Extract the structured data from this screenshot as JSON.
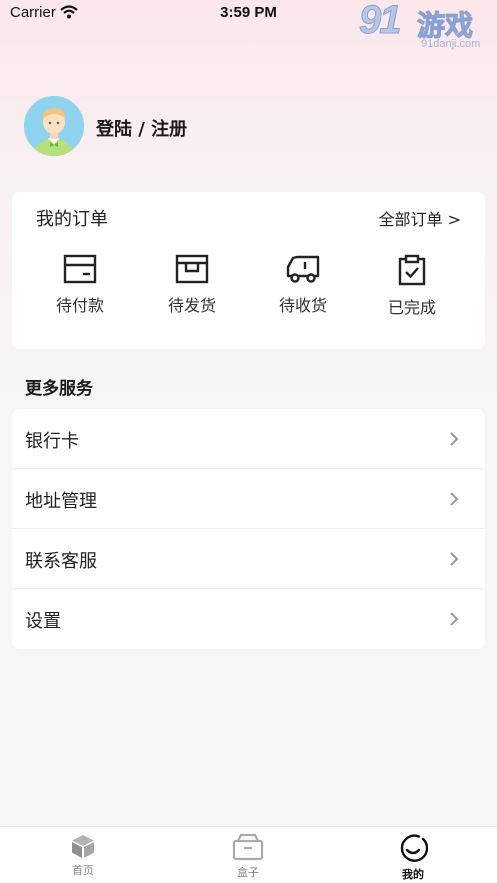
{
  "status_bar": {
    "carrier": "Carrier",
    "time": "3:59 PM"
  },
  "watermark": {
    "logo": "91",
    "name": "游戏",
    "url": "91danji.com"
  },
  "profile": {
    "login_label": "登陆 / 注册"
  },
  "orders": {
    "title": "我的订单",
    "all_link": "全部订单 >",
    "items": [
      {
        "label": "待付款",
        "icon": "wallet-icon"
      },
      {
        "label": "待发货",
        "icon": "box-icon"
      },
      {
        "label": "待收货",
        "icon": "truck-icon"
      },
      {
        "label": "已完成",
        "icon": "clipboard-check-icon"
      }
    ]
  },
  "services": {
    "title": "更多服务",
    "items": [
      {
        "label": "银行卡"
      },
      {
        "label": "地址管理"
      },
      {
        "label": "联系客服"
      },
      {
        "label": "设置"
      }
    ]
  },
  "tabbar": {
    "items": [
      {
        "label": "首页",
        "icon": "cube-icon"
      },
      {
        "label": "盒子",
        "icon": "box-tab-icon"
      },
      {
        "label": "我的",
        "icon": "smile-icon"
      }
    ],
    "active": "我的"
  }
}
